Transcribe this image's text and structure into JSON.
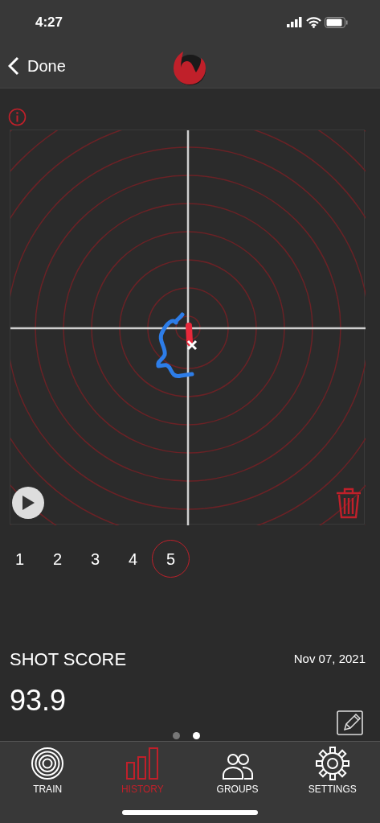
{
  "status_bar": {
    "time": "4:27"
  },
  "nav": {
    "back_label": "Done"
  },
  "shots": [
    {
      "label": "1",
      "selected": false
    },
    {
      "label": "2",
      "selected": false
    },
    {
      "label": "3",
      "selected": false
    },
    {
      "label": "4",
      "selected": false
    },
    {
      "label": "5",
      "selected": true
    }
  ],
  "score": {
    "label": "SHOT SCORE",
    "date": "Nov 07, 2021",
    "value": "93.9"
  },
  "pages": [
    {
      "selected": false
    },
    {
      "selected": true
    }
  ],
  "tabs": [
    {
      "kind": "train",
      "label": "TRAIN",
      "selected": false
    },
    {
      "kind": "history",
      "label": "HISTORY",
      "selected": true
    },
    {
      "kind": "groups",
      "label": "GROUPS",
      "selected": false
    },
    {
      "kind": "settings",
      "label": "SETTINGS",
      "selected": false
    }
  ]
}
